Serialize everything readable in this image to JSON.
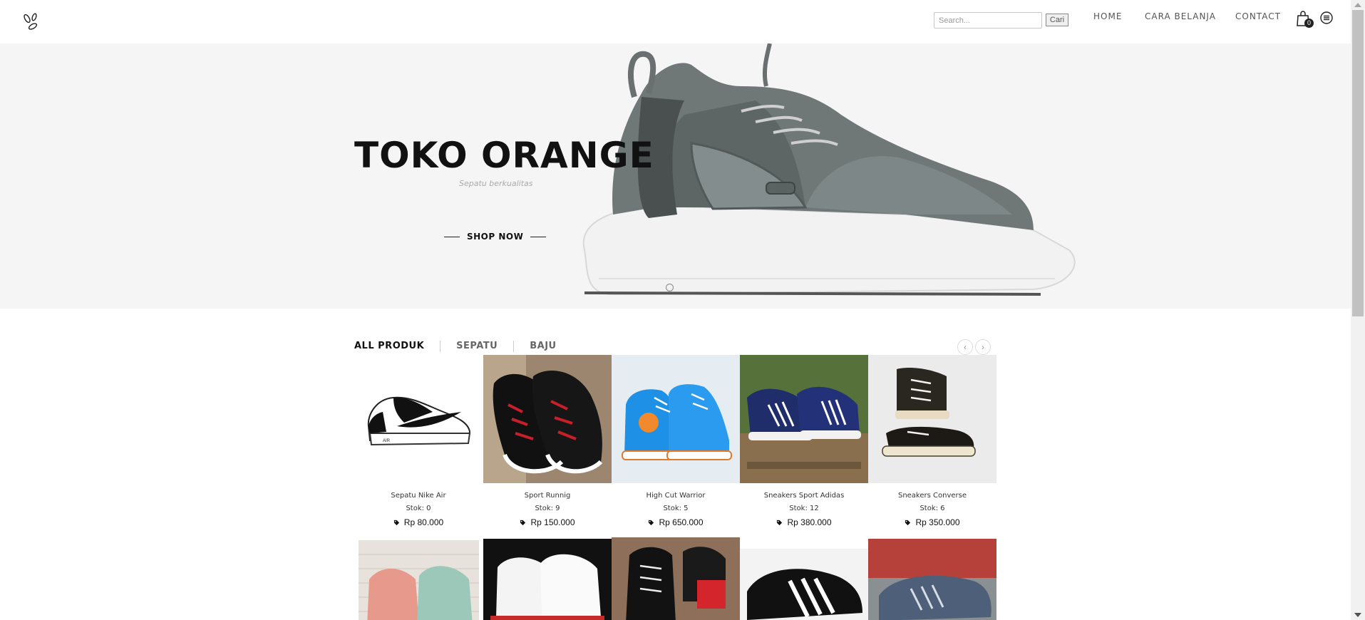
{
  "header": {
    "search": {
      "placeholder": "Search...",
      "button_label": "Cari"
    },
    "nav": [
      {
        "label": "HOME"
      },
      {
        "label": "CARA BELANJA"
      },
      {
        "label": "CONTACT"
      }
    ],
    "cart_count": "0"
  },
  "hero": {
    "title": "TOKO ORANGE",
    "subtitle": "Sepatu berkualitas",
    "cta_label": "SHOP NOW",
    "image_icon": "gray-running-shoe-image"
  },
  "filters": {
    "tabs": [
      {
        "label": "ALL PRODUK"
      },
      {
        "label": "SEPATU"
      },
      {
        "label": "BAJU"
      }
    ],
    "prev_glyph": "‹",
    "next_glyph": "›"
  },
  "products": [
    {
      "name": "Sepatu Nike Air",
      "stock": "Stok: 0",
      "price": "Rp 80.000",
      "image": "nike-air-sneaker-image"
    },
    {
      "name": "Sport Runnig",
      "stock": "Stok: 9",
      "price": "Rp 150.000",
      "image": "black-red-running-shoe-image"
    },
    {
      "name": "High Cut Warrior",
      "stock": "Stok: 5",
      "price": "Rp 650.000",
      "image": "blue-high-top-sneaker-image"
    },
    {
      "name": "Sneakers Sport Adidas",
      "stock": "Stok: 12",
      "price": "Rp 380.000",
      "image": "navy-adidas-sneaker-image"
    },
    {
      "name": "Sneakers Converse",
      "stock": "Stok: 6",
      "price": "Rp 350.000",
      "image": "black-converse-sneaker-image"
    }
  ],
  "products_row2": [
    {
      "image": "pink-green-blouses-image"
    },
    {
      "image": "white-sneakers-image"
    },
    {
      "image": "black-high-top-converse-image"
    },
    {
      "image": "black-adidas-sneaker-image"
    },
    {
      "image": "gray-knit-sneaker-image"
    }
  ],
  "colors": {
    "hero_bg": "#f5f5f5",
    "text_dark": "#111111",
    "nav_text": "#555555"
  }
}
